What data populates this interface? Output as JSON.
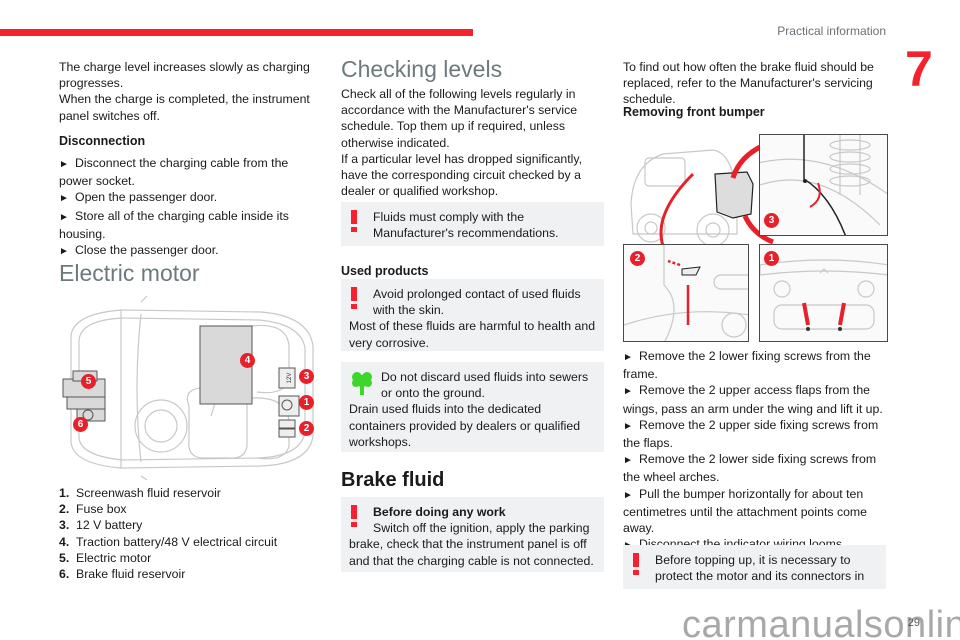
{
  "header": {
    "section_title": "Practical information",
    "chapter_number": "7",
    "accent_color": "#f5222d"
  },
  "col1": {
    "intro_lines": [
      "The charge level increases slowly as charging progresses.",
      "When the charge is completed, the instrument panel switches off."
    ],
    "disconnection": {
      "heading": "Disconnection",
      "steps": [
        "Disconnect the charging cable from the power socket.",
        "Open the passenger door.",
        "Store all of the charging cable inside its housing.",
        "Close the passenger door."
      ]
    },
    "electric_motor": {
      "heading": "Electric motor",
      "diagram_badges": [
        "1",
        "2",
        "3",
        "4",
        "5",
        "6"
      ],
      "battery_label": "12V",
      "legend": [
        {
          "num": "1.",
          "label": "Screenwash fluid reservoir"
        },
        {
          "num": "2.",
          "label": "Fuse box"
        },
        {
          "num": "3.",
          "label": "12 V battery"
        },
        {
          "num": "4.",
          "label": "Traction battery/48 V electrical circuit"
        },
        {
          "num": "5.",
          "label": "Electric motor"
        },
        {
          "num": "6.",
          "label": "Brake fluid reservoir"
        }
      ]
    }
  },
  "col2": {
    "checking_levels": {
      "heading": "Checking levels",
      "paragraphs": [
        "Check all of the following levels regularly in accordance with the Manufacturer's service schedule. Top them up if required, unless otherwise indicated.",
        "If a particular level has dropped significantly, have the corresponding circuit checked by a dealer or qualified workshop."
      ],
      "warning": "Fluids must comply with the Manufacturer's recommendations."
    },
    "used_products": {
      "heading": "Used products",
      "warning_lead": "Avoid prolonged contact of used fluids with the skin.",
      "warning_rest": "Most of these fluids are harmful to health and very corrosive.",
      "eco_lead": "Do not discard used fluids into sewers or onto the ground.",
      "eco_rest": "Drain used fluids into the dedicated containers provided by dealers or qualified workshops."
    },
    "brake_fluid": {
      "heading": "Brake fluid",
      "warning_title": "Before doing any work",
      "warning_lead": "Switch off the ignition, apply the parking",
      "warning_rest": "brake, check that the instrument panel is off and that the charging cable is not connected."
    }
  },
  "col3": {
    "intro": "To find out how often the brake fluid should be replaced, refer to the Manufacturer's servicing schedule.",
    "removing_bumper": {
      "heading": "Removing front bumper",
      "panel_badges": [
        "3",
        "2",
        "1"
      ],
      "steps": [
        "Remove the 2 lower fixing screws from the frame.",
        "Remove the 2 upper access flaps from the wings, pass an arm under the wing and lift it up.",
        "Remove the 2 upper side fixing screws from the flaps.",
        "Remove the 2 lower side fixing screws from the wheel arches.",
        "Pull the bumper horizontally for about ten centimetres until the attachment points come away.",
        "Disconnect the indicator wiring looms."
      ],
      "warning": "Before topping up, it is necessary to protect the motor and its connectors in"
    }
  },
  "footer": {
    "page_number": "29",
    "watermark": "carmanualsonline.info"
  },
  "icons": {
    "bullet": "►"
  }
}
